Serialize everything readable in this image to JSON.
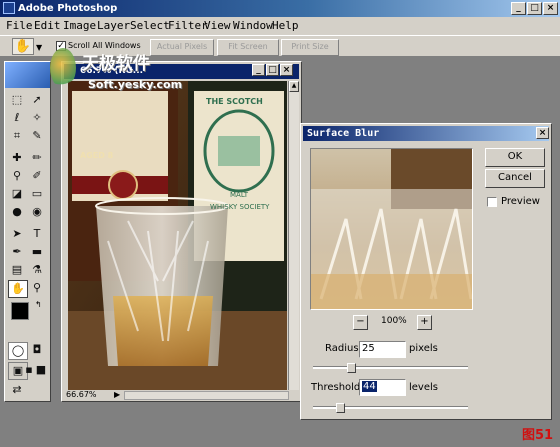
{
  "app": {
    "title": "Adobe Photoshop",
    "min": "_",
    "max": "□",
    "close": "×"
  },
  "menu": [
    "File",
    "Edit",
    "Image",
    "Layer",
    "Select",
    "Filter",
    "View",
    "Window",
    "Help"
  ],
  "options": {
    "scroll_all": "Scroll All Windows",
    "actual_pixels": "Actual Pixels",
    "fit_screen": "Fit Screen",
    "print_size": "Print Size"
  },
  "watermark": {
    "cn": "天极软件",
    "url": "Soft.yesky.com"
  },
  "document": {
    "title": "66.7% (RG...",
    "zoom": "66.67%",
    "label_left": "AGED 8",
    "label_right_lines": [
      "THE SCOTCH",
      "MALT",
      "WHISKY SOCIETY"
    ]
  },
  "dialog": {
    "title": "Surface Blur",
    "ok": "OK",
    "cancel": "Cancel",
    "preview": "Preview",
    "zoom": "100%",
    "zoom_out": "−",
    "zoom_in": "+",
    "radius_label": "Radius:",
    "radius_value": "25",
    "radius_unit": "pixels",
    "threshold_label": "Threshold:",
    "threshold_value": "44",
    "threshold_unit": "levels",
    "close": "×"
  },
  "figure_label": "图51"
}
